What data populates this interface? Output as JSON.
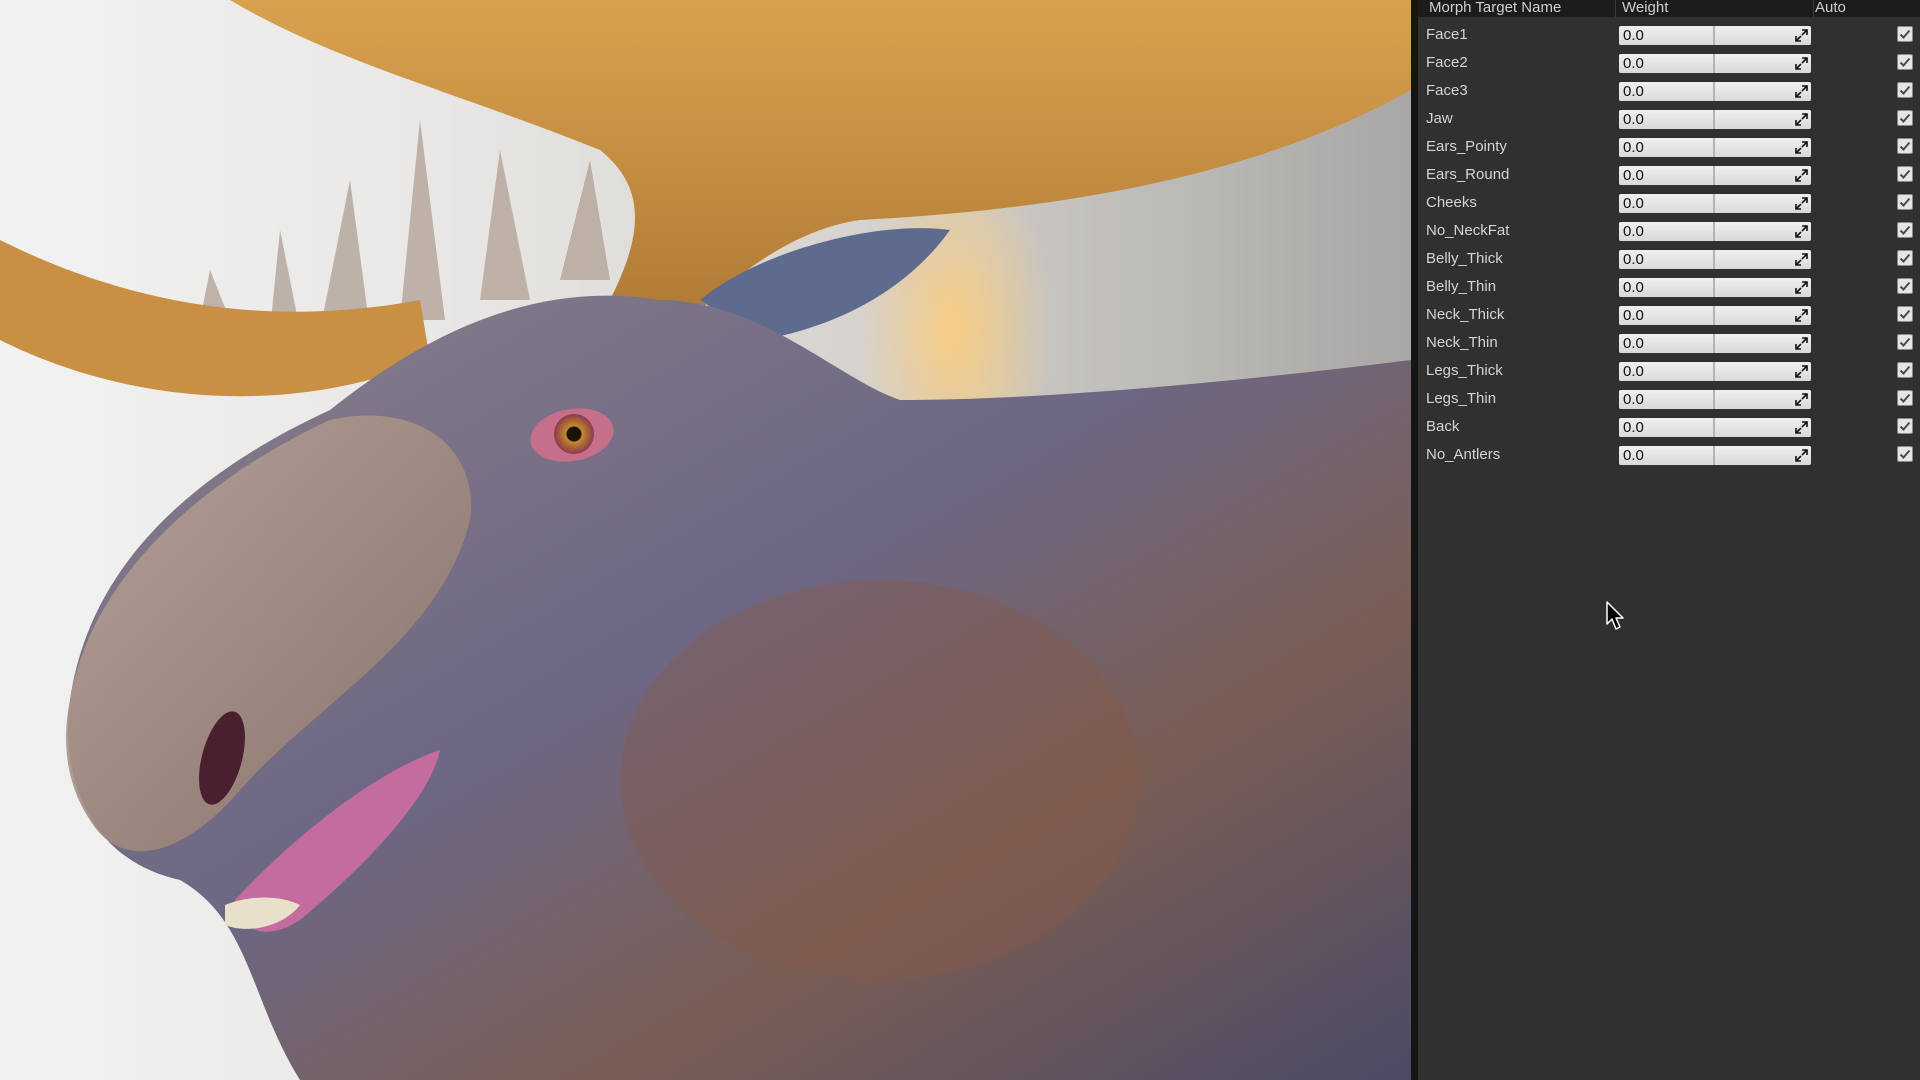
{
  "panel": {
    "headers": {
      "name": "Morph Target Name",
      "weight": "Weight",
      "auto": "Auto"
    },
    "rows": [
      {
        "name": "Face1",
        "weight": "0.0",
        "auto": true
      },
      {
        "name": "Face2",
        "weight": "0.0",
        "auto": true
      },
      {
        "name": "Face3",
        "weight": "0.0",
        "auto": true
      },
      {
        "name": "Jaw",
        "weight": "0.0",
        "auto": true
      },
      {
        "name": "Ears_Pointy",
        "weight": "0.0",
        "auto": true
      },
      {
        "name": "Ears_Round",
        "weight": "0.0",
        "auto": true
      },
      {
        "name": "Cheeks",
        "weight": "0.0",
        "auto": true
      },
      {
        "name": "No_NeckFat",
        "weight": "0.0",
        "auto": true
      },
      {
        "name": "Belly_Thick",
        "weight": "0.0",
        "auto": true
      },
      {
        "name": "Belly_Thin",
        "weight": "0.0",
        "auto": true
      },
      {
        "name": "Neck_Thick",
        "weight": "0.0",
        "auto": true
      },
      {
        "name": "Neck_Thin",
        "weight": "0.0",
        "auto": true
      },
      {
        "name": "Legs_Thick",
        "weight": "0.0",
        "auto": true
      },
      {
        "name": "Legs_Thin",
        "weight": "0.0",
        "auto": true
      },
      {
        "name": "Back",
        "weight": "0.0",
        "auto": true
      },
      {
        "name": "No_Antlers",
        "weight": "0.0",
        "auto": true
      }
    ]
  },
  "icons": {
    "slider": "expand-arrows-icon",
    "checkbox": "checkmark-icon",
    "cursor": "mouse-pointer-icon"
  }
}
